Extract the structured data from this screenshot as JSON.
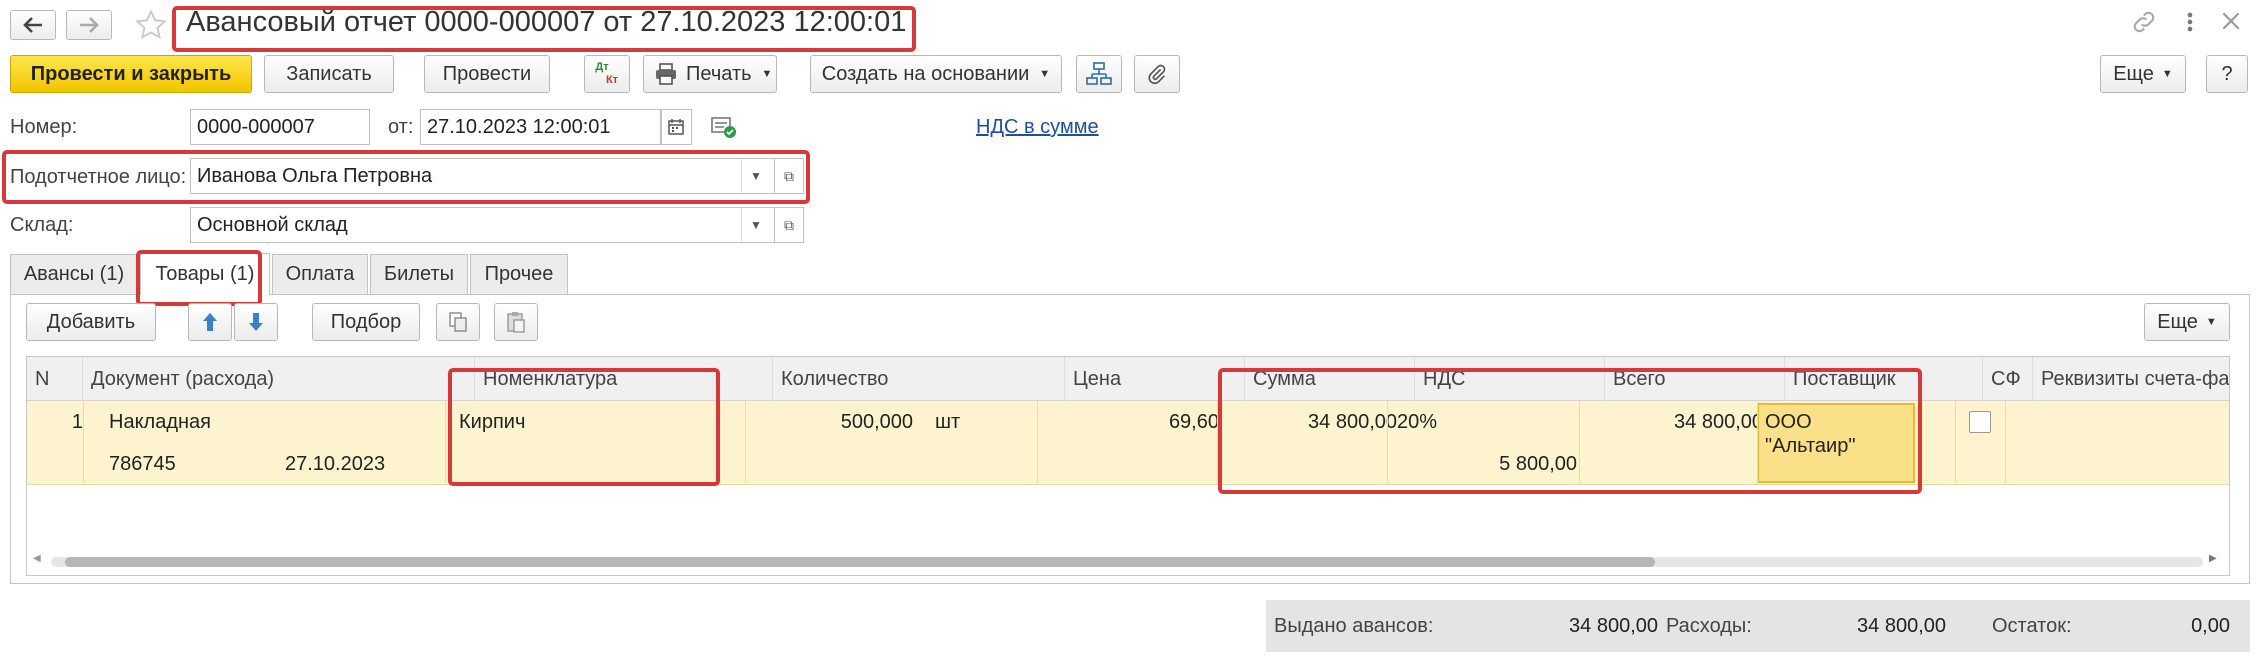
{
  "title": "Авансовый отчет 0000-000007 от 27.10.2023 12:00:01",
  "toolbar": {
    "post_close": "Провести и закрыть",
    "save": "Записать",
    "post": "Провести",
    "dtkt_top": "Дт",
    "dtkt_bottom": "Кт",
    "print": "Печать",
    "create_based": "Создать на основании",
    "more": "Еще",
    "help": "?"
  },
  "header": {
    "number_label": "Номер:",
    "number_value": "0000-000007",
    "from_label": "от:",
    "date_value": "27.10.2023 12:00:01",
    "vat_link": "НДС в сумме",
    "person_label": "Подотчетное лицо:",
    "person_value": "Иванова Ольга Петровна",
    "warehouse_label": "Склад:",
    "warehouse_value": "Основной склад"
  },
  "tabs": [
    {
      "label": "Авансы (1)"
    },
    {
      "label": "Товары (1)"
    },
    {
      "label": "Оплата"
    },
    {
      "label": "Билеты"
    },
    {
      "label": "Прочее"
    }
  ],
  "table_toolbar": {
    "add": "Добавить",
    "pick": "Подбор",
    "more": "Еще"
  },
  "table": {
    "columns": [
      "N",
      "Документ (расхода)",
      "Номенклатура",
      "Количество",
      "Цена",
      "Сумма",
      "НДС",
      "Всего",
      "Поставщик",
      "СФ",
      "Реквизиты счета-факту"
    ],
    "rows": [
      {
        "n": "1",
        "doc": "Накладная",
        "doc_number": "786745",
        "doc_date": "27.10.2023",
        "item": "Кирпич",
        "qty": "500,000",
        "unit": "шт",
        "price": "69,60",
        "sum": "34 800,00",
        "vat_rate": "20%",
        "vat_sum": "5 800,00",
        "total": "34 800,00",
        "supplier_line1": "ООО",
        "supplier_line2": "\"Альтаир\"",
        "sf_checked": false
      }
    ]
  },
  "totals": {
    "advances_label": "Выдано авансов:",
    "advances_value": "34 800,00",
    "expenses_label": "Расходы:",
    "expenses_value": "34 800,00",
    "balance_label": "Остаток:",
    "balance_value": "0,00"
  },
  "colors": {
    "accent_red": "#d6393a",
    "primary_button": "#f5cc00",
    "row_highlight": "#fdf4cf",
    "link": "#1f4e9c"
  }
}
